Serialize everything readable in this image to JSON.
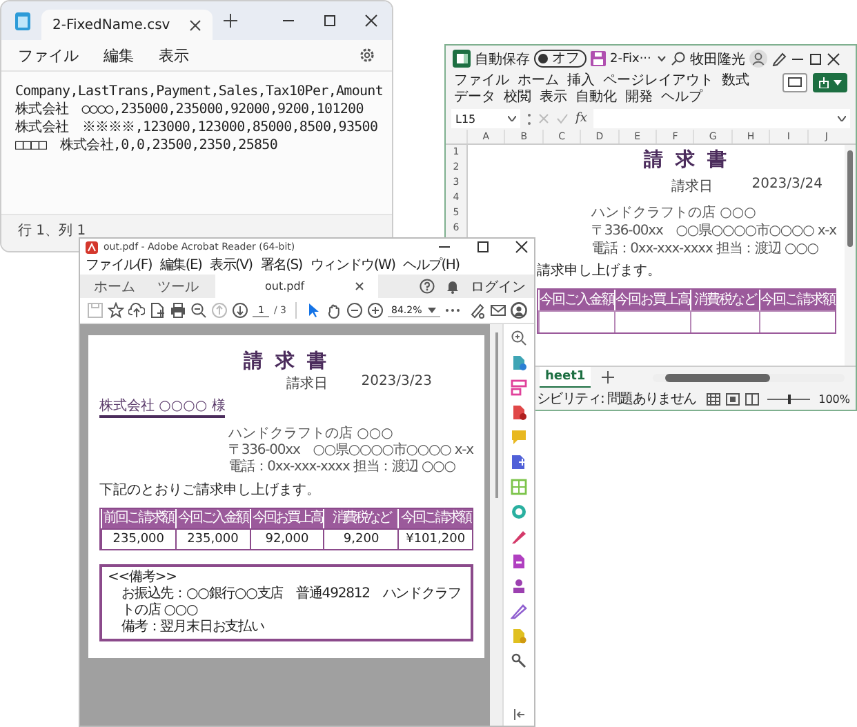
{
  "notepad": {
    "tab_title": "2-FixedName.csv",
    "menu": [
      "ファイル",
      "編集",
      "表示"
    ],
    "lines": [
      "Company,LastTrans,Payment,Sales,Tax10Per,Amount",
      "株式会社　○○○○,235000,235000,92000,9200,101200",
      "株式会社　※※※※,123000,123000,85000,8500,93500",
      "□□□□　株式会社,0,0,23500,2350,25850"
    ],
    "status": "行 1、列 1"
  },
  "excel": {
    "autosave": {
      "label": "自動保存",
      "state_text": "オフ",
      "on": false
    },
    "file_name": "2-Fix···",
    "user_name": "牧田隆光",
    "ribbon_tabs": [
      "ファイル",
      "ホーム",
      "挿入",
      "ページレイアウト",
      "数式",
      "データ",
      "校閲",
      "表示",
      "自動化",
      "開発",
      "ヘルプ"
    ],
    "name_box": "L15",
    "formula_button": "fx",
    "columns": [
      "A",
      "B",
      "C",
      "D",
      "E",
      "F",
      "G",
      "H",
      "I",
      "J"
    ],
    "rows": [
      "1",
      "2",
      "3",
      "4",
      "5",
      "6"
    ],
    "sheet": {
      "title": "請 求 書",
      "date_label": "請求日",
      "date": "2023/3/24",
      "address": [
        "ハンドクラフトの店 ○○○",
        "〒336-00xx　○○県○○○○市○○○○ x-x",
        "電話：0xx-xxx-xxxx 担当：渡辺 ○○○"
      ],
      "message": "請求申し上げます。",
      "table_headers": [
        "今回ご入金額",
        "今回お買上高",
        "消費税など",
        "今回ご請求額"
      ]
    },
    "sheet_tabs": [
      {
        "label": "heet1",
        "selected": true
      }
    ],
    "status": "シビリティ: 問題ありません",
    "zoom_slider": {
      "level": 0.5
    },
    "zoom": "100%"
  },
  "acrobat": {
    "title": "out.pdf - Adobe Acrobat Reader (64-bit)",
    "menu": [
      "ファイル(F)",
      "編集(E)",
      "表示(V)",
      "署名(S)",
      "ウィンドウ(W)",
      "ヘルプ(H)"
    ],
    "tabs": [
      {
        "label": "ホーム",
        "selected": false
      },
      {
        "label": "ツール",
        "selected": false
      },
      {
        "label": "out.pdf",
        "selected": true
      }
    ],
    "login": "ログイン",
    "page_current": "1",
    "page_total": "/ 3",
    "zoom": "84.2%",
    "document": {
      "title": "請 求 書",
      "date_label": "請求日",
      "date": "2023/3/23",
      "customer": "株式会社 ○○○○ 様",
      "address": [
        "ハンドクラフトの店 ○○○",
        "〒336-00xx　○○県○○○○市○○○○ x-x",
        "電話：0xx-xxx-xxxx 担当：渡辺 ○○○"
      ],
      "message": "下記のとおりご請求申し上げます。",
      "table": {
        "columns": [
          "前回ご請求額",
          "今回ご入金額",
          "今回お買上高",
          "消費税など",
          "今回ご請求額"
        ],
        "rows": [
          [
            "235,000",
            "235,000",
            "92,000",
            "9,200",
            "¥101,200"
          ]
        ]
      },
      "remarks": [
        "<<備考>>",
        "お振込先：○○銀行○○支店　普通492812　ハンドクラフトの店 ○○○",
        "備考：翌月末日お支払い"
      ]
    }
  }
}
